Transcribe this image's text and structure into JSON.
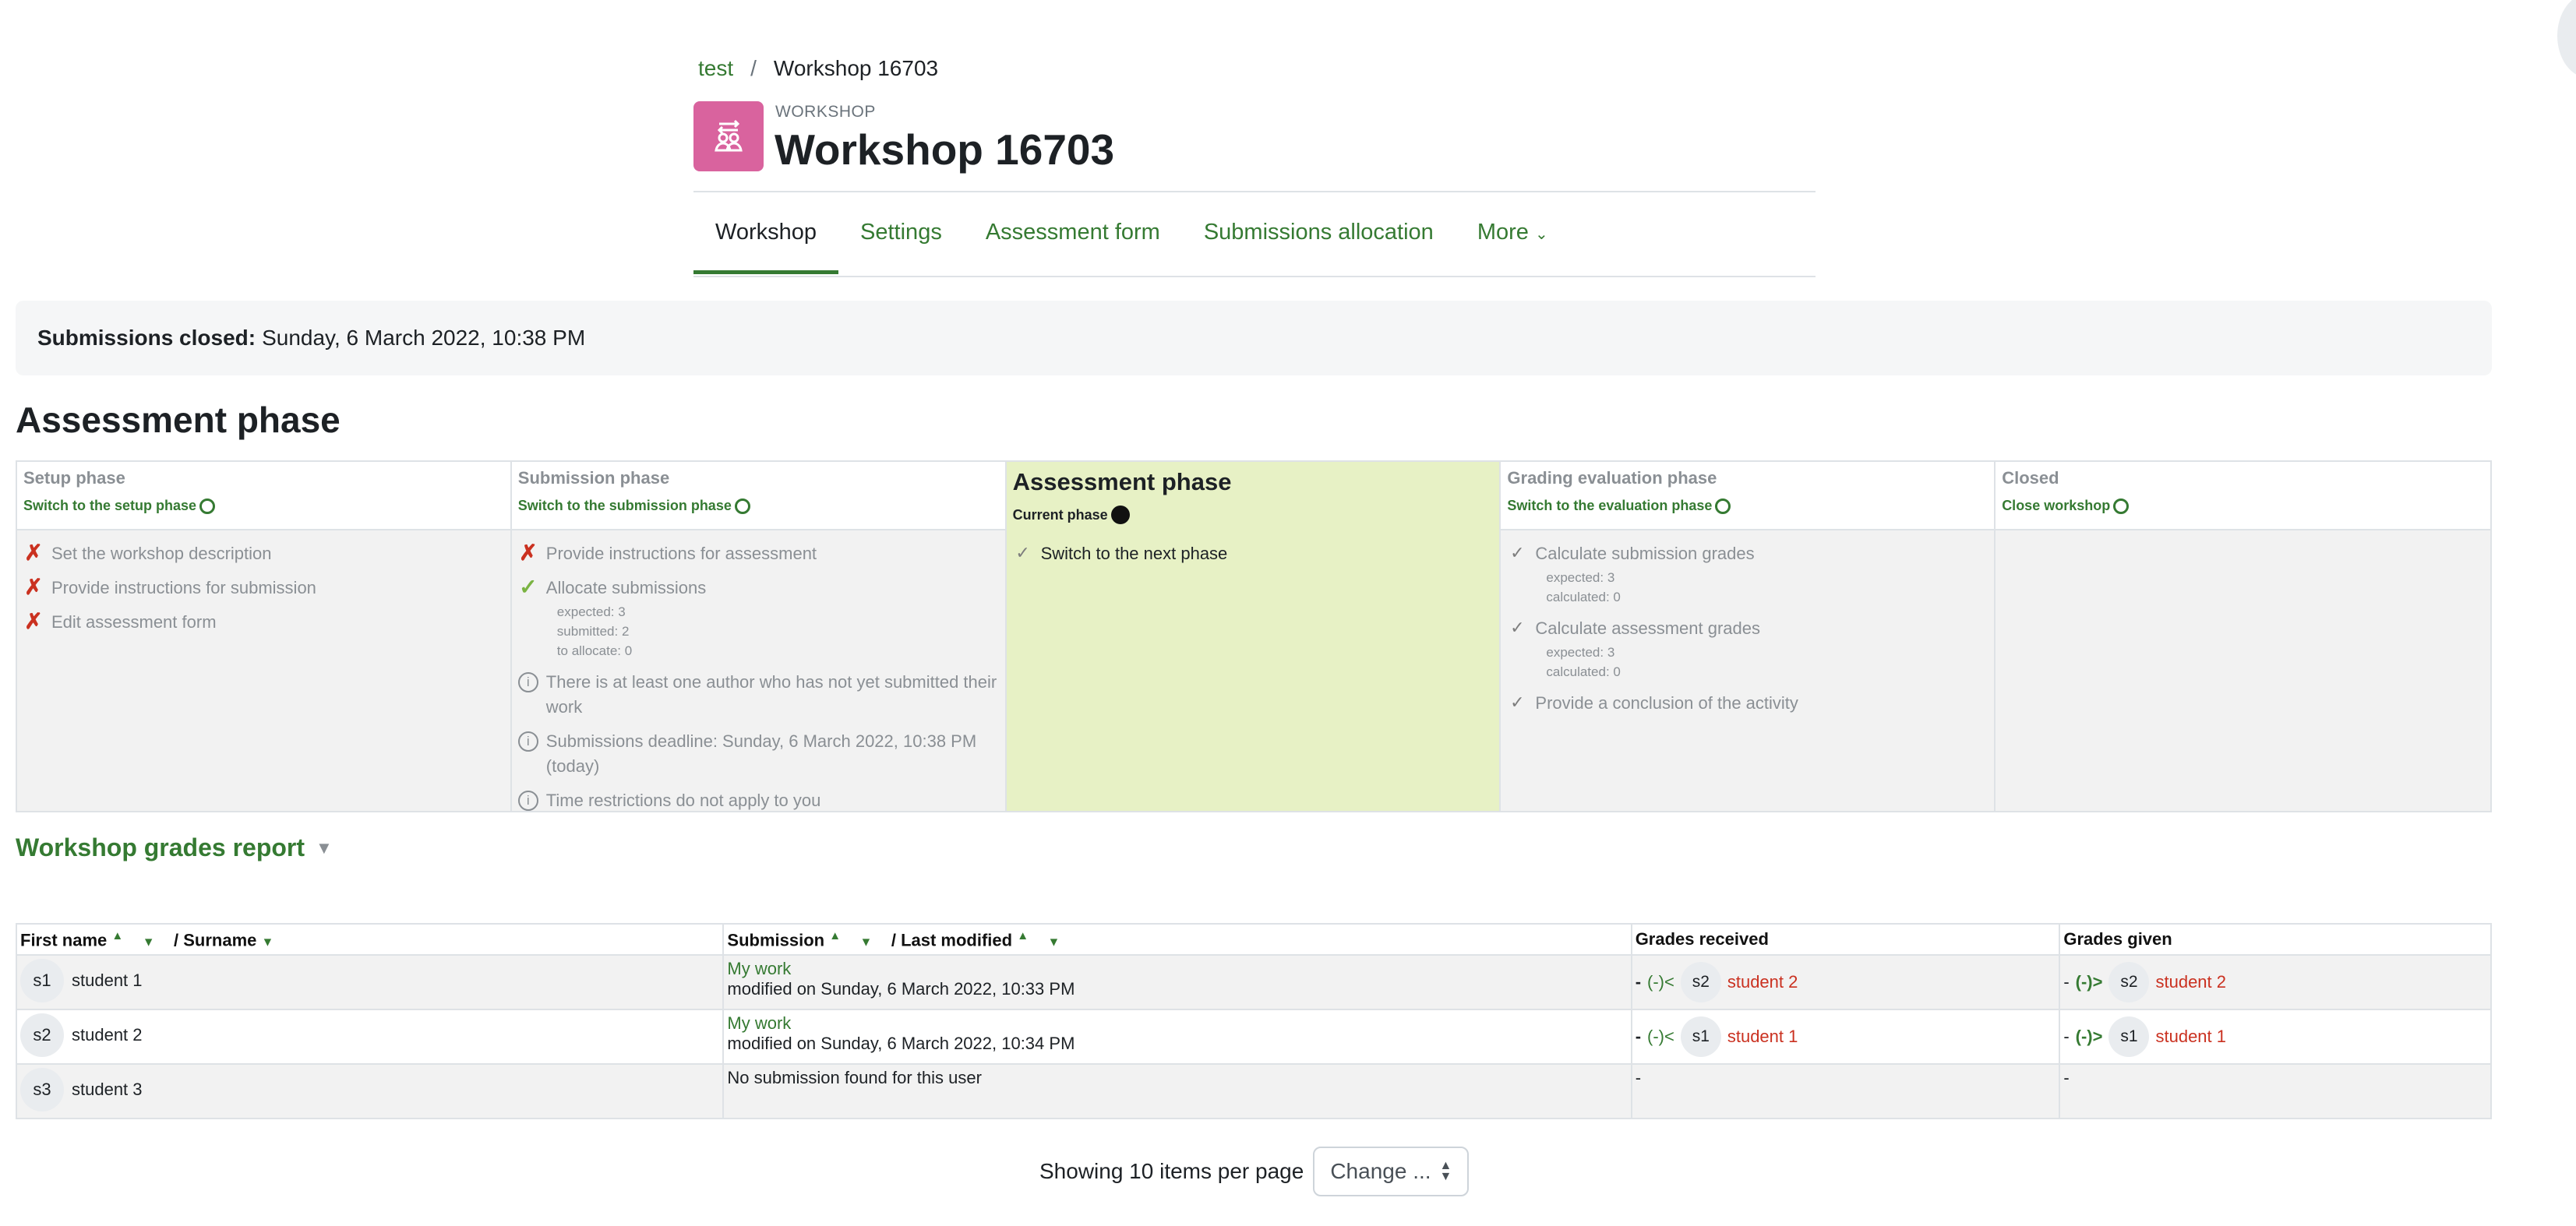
{
  "breadcrumb": {
    "parent": "test",
    "separator": "/",
    "current": "Workshop 16703"
  },
  "header": {
    "module_label": "WORKSHOP",
    "title": "Workshop 16703"
  },
  "tabs": [
    {
      "label": "Workshop",
      "active": true
    },
    {
      "label": "Settings"
    },
    {
      "label": "Assessment form"
    },
    {
      "label": "Submissions allocation"
    },
    {
      "label": "More"
    }
  ],
  "submissions_closed": {
    "label": "Submissions closed:",
    "value": "Sunday, 6 March 2022, 10:38 PM"
  },
  "phase_heading": "Assessment phase",
  "phases": [
    {
      "title": "Setup phase",
      "switch": "Switch to the setup phase",
      "tasks": [
        {
          "status": "fail",
          "text": "Set the workshop description"
        },
        {
          "status": "fail",
          "text": "Provide instructions for submission"
        },
        {
          "status": "fail",
          "text": "Edit assessment form"
        }
      ]
    },
    {
      "title": "Submission phase",
      "switch": "Switch to the submission phase",
      "tasks": [
        {
          "status": "fail",
          "text": "Provide instructions for assessment"
        },
        {
          "status": "done",
          "text": "Allocate submissions",
          "details": [
            "expected: 3",
            "submitted: 2",
            "to allocate: 0"
          ]
        },
        {
          "status": "info",
          "text": "There is at least one author who has not yet submitted their work"
        },
        {
          "status": "info",
          "text": "Submissions deadline: Sunday, 6 March 2022, 10:38 PM (today)"
        },
        {
          "status": "info",
          "text": "Time restrictions do not apply to you"
        }
      ]
    },
    {
      "title": "Assessment phase",
      "switch": "Current phase",
      "current": true,
      "tasks": [
        {
          "status": "todo",
          "text": "Switch to the next phase"
        }
      ]
    },
    {
      "title": "Grading evaluation phase",
      "switch": "Switch to the evaluation phase",
      "tasks": [
        {
          "status": "todo",
          "text": "Calculate submission grades",
          "details": [
            "expected: 3",
            "calculated: 0"
          ]
        },
        {
          "status": "todo",
          "text": "Calculate assessment grades",
          "details": [
            "expected: 3",
            "calculated: 0"
          ]
        },
        {
          "status": "todo",
          "text": "Provide a conclusion of the activity"
        }
      ]
    },
    {
      "title": "Closed",
      "switch": "Close workshop",
      "tasks": []
    }
  ],
  "report": {
    "heading": "Workshop grades report",
    "columns": {
      "first_name": "First name",
      "surname": "/ Surname",
      "submission": "Submission",
      "last_modified": "/ Last modified",
      "grades_received": "Grades received",
      "grades_given": "Grades given"
    },
    "rows": [
      {
        "initials": "s1",
        "name": "student 1",
        "work": "My work",
        "modified": "modified on Sunday, 6 March 2022, 10:33 PM",
        "received": {
          "prefix": "-",
          "grade": "(-)<",
          "initials": "s2",
          "name": "student 2"
        },
        "given": {
          "prefix": "-",
          "grade": "(-)>",
          "initials": "s2",
          "name": "student 2"
        }
      },
      {
        "initials": "s2",
        "name": "student 2",
        "work": "My work",
        "modified": "modified on Sunday, 6 March 2022, 10:34 PM",
        "received": {
          "prefix": "-",
          "grade": "(-)<",
          "initials": "s1",
          "name": "student 1"
        },
        "given": {
          "prefix": "-",
          "grade": "(-)>",
          "initials": "s1",
          "name": "student 1"
        }
      },
      {
        "initials": "s3",
        "name": "student 3",
        "no_submission": "No submission found for this user",
        "received_text": "-",
        "given_text": "-"
      }
    ]
  },
  "paging": {
    "text": "Showing 10 items per page",
    "select_value": "Change ..."
  }
}
